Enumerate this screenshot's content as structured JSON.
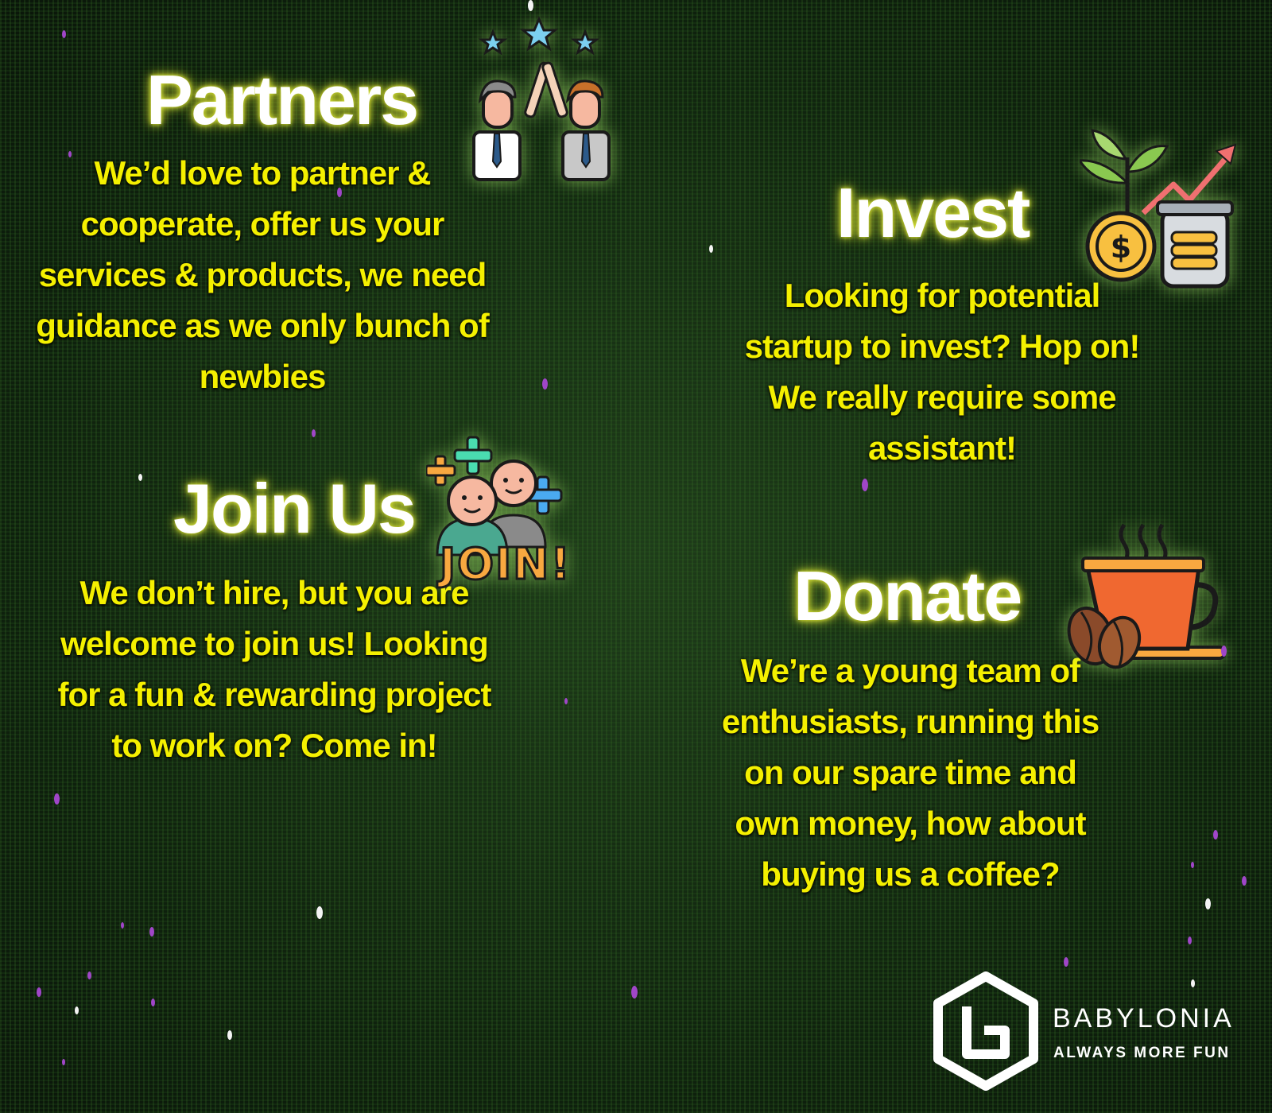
{
  "sections": {
    "partners": {
      "title": "Partners",
      "lines": [
        "We’d love to partner &",
        "cooperate, offer us your",
        "services & products, we need",
        "guidance as we only bunch of",
        "newbies"
      ],
      "icon": "high-five-icon"
    },
    "invest": {
      "title": "Invest",
      "lines": [
        "Looking for potential",
        "startup to invest? Hop on!",
        "We really require some",
        "assistant!"
      ],
      "icon": "investment-growth-icon"
    },
    "join": {
      "title": "Join Us",
      "lines": [
        "We don’t hire, but you are",
        "welcome to  join us! Looking",
        "for a fun & rewarding project",
        "to work on? Come in!"
      ],
      "icon": "join-team-icon",
      "icon_text": "JOIN!"
    },
    "donate": {
      "title": "Donate",
      "lines": [
        "We’re a young team of",
        "enthusiasts, running this",
        "on our spare time and",
        "own money, how about",
        "buying us a coffee?"
      ],
      "icon": "coffee-cup-icon"
    }
  },
  "brand": {
    "name": "BABYLONIA",
    "tagline": "ALWAYS MORE FUN",
    "icon": "babylonia-logo-icon"
  },
  "colors": {
    "heading": "#ffffff",
    "heading_glow": "#d8e23a",
    "body_text": "#f4f000",
    "background": "#0d1a0d",
    "sparkle_purple": "#a046c8"
  }
}
